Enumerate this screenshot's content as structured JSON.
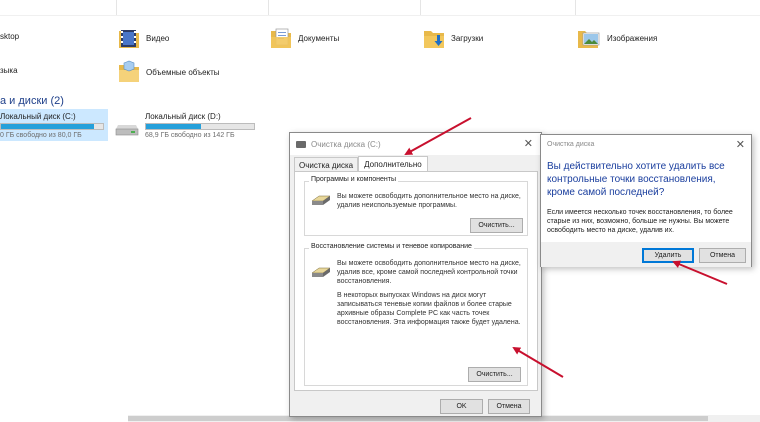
{
  "explorer": {
    "folders": {
      "desktop_partial": "sktop",
      "video": "Видео",
      "documents": "Документы",
      "downloads": "Загрузки",
      "images": "Изображения",
      "music_partial": "зыка",
      "objects3d": "Объемные объекты"
    },
    "section_title": "а и диски (2)",
    "drives": [
      {
        "name": "Локальный диск (C:)",
        "free": "0 ГБ свободно из 80,0 ГБ",
        "used_fraction": 0.91
      },
      {
        "name": "Локальный диск (D:)",
        "free": "68,9 ГБ свободно из 142 ГБ",
        "used_fraction": 0.51
      }
    ]
  },
  "cleanup_dialog": {
    "title": "Очистка диска (C:)",
    "close_glyph": "✕",
    "tabs": [
      "Очистка диска",
      "Дополнительно"
    ],
    "programs_group": {
      "title": "Программы и компоненты",
      "text": "Вы можете освободить дополнительное место на диске, удалив неиспользуемые программы.",
      "button": "Очистить..."
    },
    "restore_group": {
      "title": "Восстановление системы и теневое копирование",
      "text1": "Вы можете освободить дополнительное место на диске, удалив все, кроме самой последней контрольной точки восстановления.",
      "text2": "В некоторых выпусках Windows на диск могут записываться теневые копии файлов и более старые архивные образы Complete PC как часть точек восстановления. Эта информация также будет удалена.",
      "button": "Очистить..."
    },
    "ok": "OK",
    "cancel": "Отмена"
  },
  "confirm_dialog": {
    "title": "Очистка диска",
    "close_glyph": "✕",
    "question": "Вы действительно хотите удалить все контрольные точки восстановления, кроме самой последней?",
    "body": "Если имеется несколько точек восстановления, то более старые из них, возможно, больше не нужны. Вы можете освободить место на диске, удалив их.",
    "delete": "Удалить",
    "cancel": "Отмена"
  },
  "colors": {
    "accent": "#0078d7",
    "annotation_arrow": "#c8102e",
    "drive_fill": "#26a0da",
    "question_text": "#1a3e9e"
  }
}
